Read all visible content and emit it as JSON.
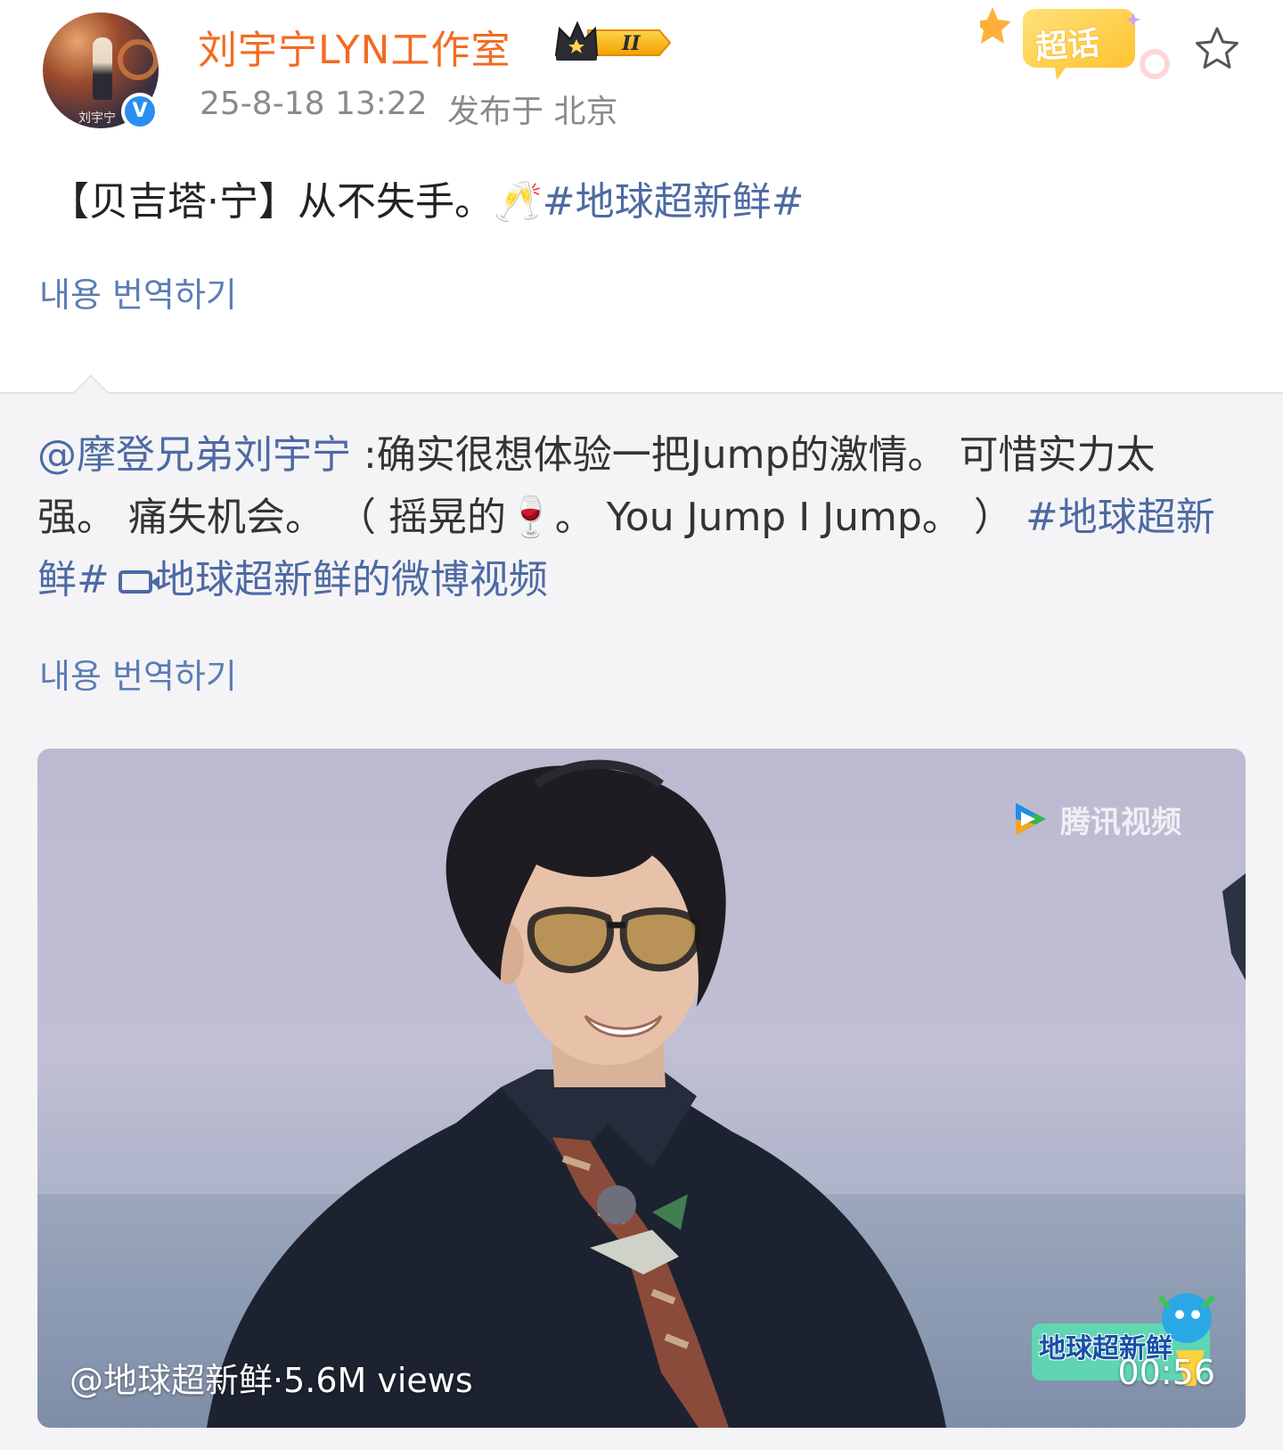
{
  "post": {
    "author": {
      "name": "刘宇宁LYN工作室",
      "avatar_signature": "刘宇宁",
      "verified_badge": "V",
      "member_level": "II"
    },
    "timestamp": "25-8-18 13:22",
    "location": "发布于 北京",
    "supertopic_badge": "超话",
    "text_prefix": "【贝吉塔·宁】从不失手。",
    "emoji": "🥂",
    "hashtag": "#地球超新鲜#",
    "translate_label": "내용 번역하기"
  },
  "repost": {
    "mention": "@摩登兄弟刘宇宁",
    "text": " :确实很想体验一把Jump的激情。 可惜实力太强。 痛失机会。 （ 摇晃的",
    "emoji": "🍷",
    "text_tail": "。 You Jump I Jump。 ）",
    "hashtag": "#地球超新鲜#",
    "video_link": "地球超新鲜的微博视频",
    "translate_label": "내용 번역하기"
  },
  "video": {
    "watermark": "腾讯视频",
    "show_logo": "地球超新鲜",
    "caption": "@地球超新鲜·5.6M views",
    "duration": "00:56"
  }
}
